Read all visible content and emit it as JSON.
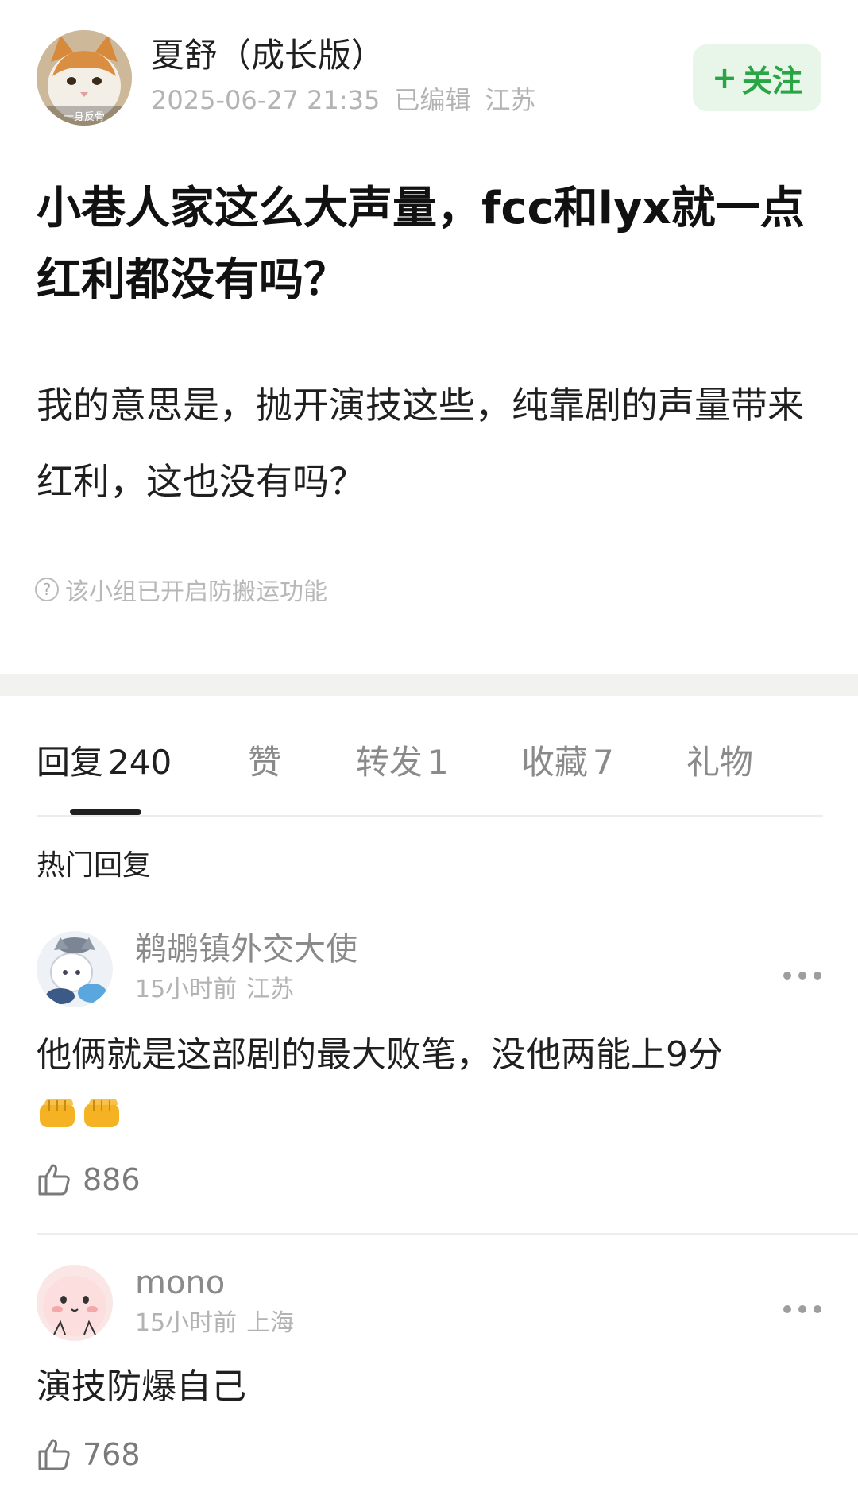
{
  "post": {
    "author_name": "夏舒（成长版）",
    "avatar_caption": "一身反骨",
    "timestamp": "2025-06-27 21:35",
    "edited": "已编辑",
    "location": "江苏",
    "follow_label": "关注",
    "title": "小巷人家这么大声量，fcc和lyx就一点红利都没有吗？",
    "body": "我的意思是，抛开演技这些，纯靠剧的声量带来红利，这也没有吗？",
    "notice": "该小组已开启防搬运功能"
  },
  "tabs": [
    {
      "label": "回复",
      "count": "240",
      "active": true
    },
    {
      "label": "赞",
      "count": "",
      "active": false
    },
    {
      "label": "转发",
      "count": "1",
      "active": false
    },
    {
      "label": "收藏",
      "count": "7",
      "active": false
    },
    {
      "label": "礼物",
      "count": "",
      "active": false
    }
  ],
  "hot_replies_label": "热门回复",
  "comments": [
    {
      "name": "鹈鹕镇外交大使",
      "time": "15小时前",
      "location": "江苏",
      "text": "他俩就是这部剧的最大败笔，没他两能上9分",
      "emoji": [
        "fist-emoji",
        "fist-emoji"
      ],
      "likes": "886"
    },
    {
      "name": "mono",
      "time": "15小时前",
      "location": "上海",
      "text": "演技防爆自己",
      "likes": "768"
    }
  ],
  "colors": {
    "accent_green": "#2aa545",
    "follow_bg": "#e8f5e9",
    "muted_text": "#b3b3b3"
  }
}
